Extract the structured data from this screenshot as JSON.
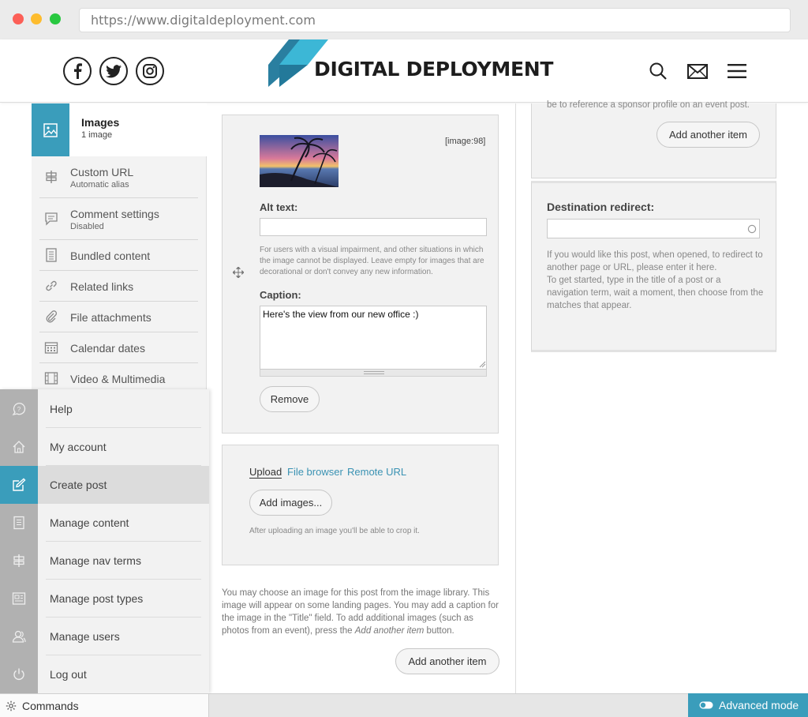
{
  "browser": {
    "url": "https://www.digitaldeployment.com"
  },
  "site": {
    "brand": "DIGITAL DEPLOYMENT",
    "accent": "#3a9dbb"
  },
  "tabs": {
    "active": {
      "title": "Images",
      "subtitle": "1 image"
    },
    "items": [
      {
        "label": "Custom URL",
        "sub": "Automatic alias",
        "icon": "signpost-icon"
      },
      {
        "label": "Comment settings",
        "sub": "Disabled",
        "icon": "comment-icon"
      },
      {
        "label": "Bundled content",
        "sub": "",
        "icon": "document-icon"
      },
      {
        "label": "Related links",
        "sub": "",
        "icon": "link-icon"
      },
      {
        "label": "File attachments",
        "sub": "",
        "icon": "paperclip-icon"
      },
      {
        "label": "Calendar dates",
        "sub": "",
        "icon": "calendar-icon"
      },
      {
        "label": "Video & Multimedia",
        "sub": "",
        "icon": "film-icon"
      }
    ]
  },
  "image_item": {
    "tag": "[image:98]",
    "alt_label": "Alt text:",
    "alt_value": "",
    "alt_help": "For users with a visual impairment, and other situations in which the image cannot be displayed. Leave empty for images that are decorational or don't convey any new information.",
    "caption_label": "Caption:",
    "caption_value": "Here's the view from our new office :)",
    "remove_label": "Remove"
  },
  "upload": {
    "tabs": [
      "Upload",
      "File browser",
      "Remote URL"
    ],
    "add_images_label": "Add images...",
    "help": "After uploading an image you'll be able to crop it."
  },
  "images_help": {
    "before": "You may choose an image for this post from the image library. This image will appear on some landing pages. You may add a caption for the image in the \"Title\" field. To add additional images (such as photos from an event), press the ",
    "emph": "Add another item",
    "after": " button."
  },
  "add_another_label": "Add another item",
  "right": {
    "cut_text": "be to reference a sponsor profile on an event post.",
    "add_another_label": "Add another item",
    "redirect_label": "Destination redirect:",
    "redirect_value": "",
    "redirect_help_1": "If you would like this post, when opened, to redirect to another page or URL, please enter it here.",
    "redirect_help_2": "To get started, type in the title of a post or a navigation term, wait a moment, then choose from the matches that appear."
  },
  "commands": {
    "items": [
      {
        "label": "Help",
        "icon": "help-icon",
        "active": false
      },
      {
        "label": "My account",
        "icon": "home-icon",
        "active": false
      },
      {
        "label": "Create post",
        "icon": "edit-icon",
        "active": true
      },
      {
        "label": "Manage content",
        "icon": "document-icon",
        "active": false
      },
      {
        "label": "Manage nav terms",
        "icon": "signpost-icon",
        "active": false
      },
      {
        "label": "Manage post types",
        "icon": "layout-icon",
        "active": false
      },
      {
        "label": "Manage users",
        "icon": "users-icon",
        "active": false
      },
      {
        "label": "Log out",
        "icon": "power-icon",
        "active": false
      }
    ],
    "bar_label": "Commands",
    "advanced_label": "Advanced mode"
  }
}
